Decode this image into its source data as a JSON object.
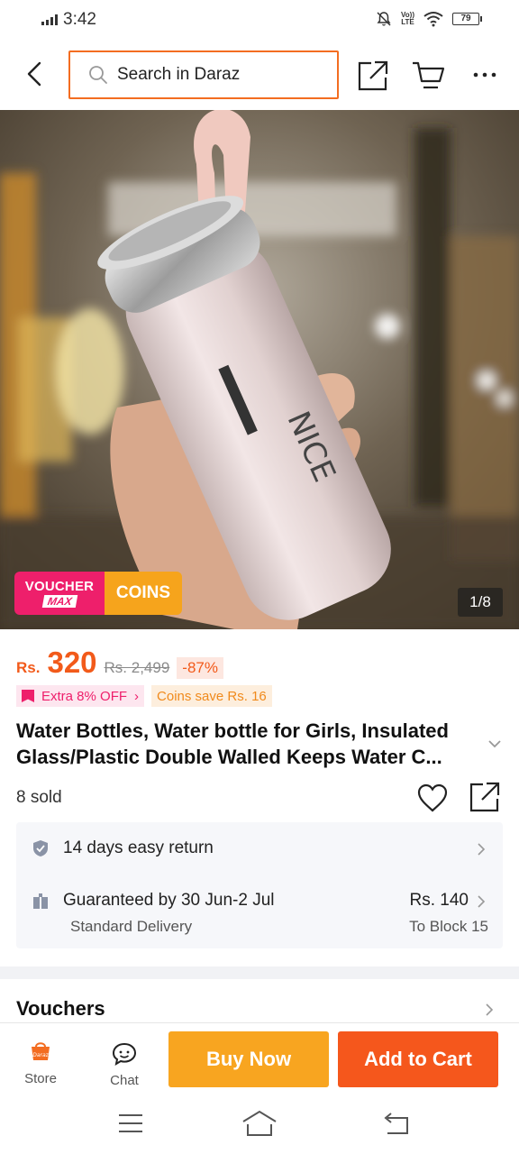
{
  "status": {
    "time": "3:42",
    "network": "Vo)) LTE",
    "battery": "79"
  },
  "search": {
    "placeholder": "Search in Daraz"
  },
  "hero": {
    "voucher_badge_line1": "VOUCHER",
    "voucher_badge_line2": "MAX",
    "coins_badge": "COINS",
    "counter": "1/8",
    "bottle_text": "NICE"
  },
  "price": {
    "currency": "Rs.",
    "current": "320",
    "original": "Rs. 2,499",
    "discount": "-87%"
  },
  "promos": {
    "extra_off": "Extra 8% OFF",
    "coins_save": "Coins save Rs. 16"
  },
  "product": {
    "title": "Water Bottles, Water bottle for Girls, Insulated Glass/Plastic Double Walled Keeps Water C...",
    "sold": "8 sold"
  },
  "delivery": {
    "return_policy": "14 days easy return",
    "guarantee": "Guaranteed by 30 Jun-2 Jul",
    "method": "Standard Delivery",
    "price": "Rs. 140",
    "destination": "To Block 15"
  },
  "sections": {
    "vouchers": "Vouchers"
  },
  "actions": {
    "store": "Store",
    "store_logo": "Daraz",
    "chat": "Chat",
    "buy_now": "Buy Now",
    "add_to_cart": "Add to Cart"
  },
  "colors": {
    "accent": "#f36d21",
    "buy": "#f8a520",
    "cart": "#f5571c",
    "price": "#f25a1a",
    "voucher": "#ee1f6b"
  }
}
